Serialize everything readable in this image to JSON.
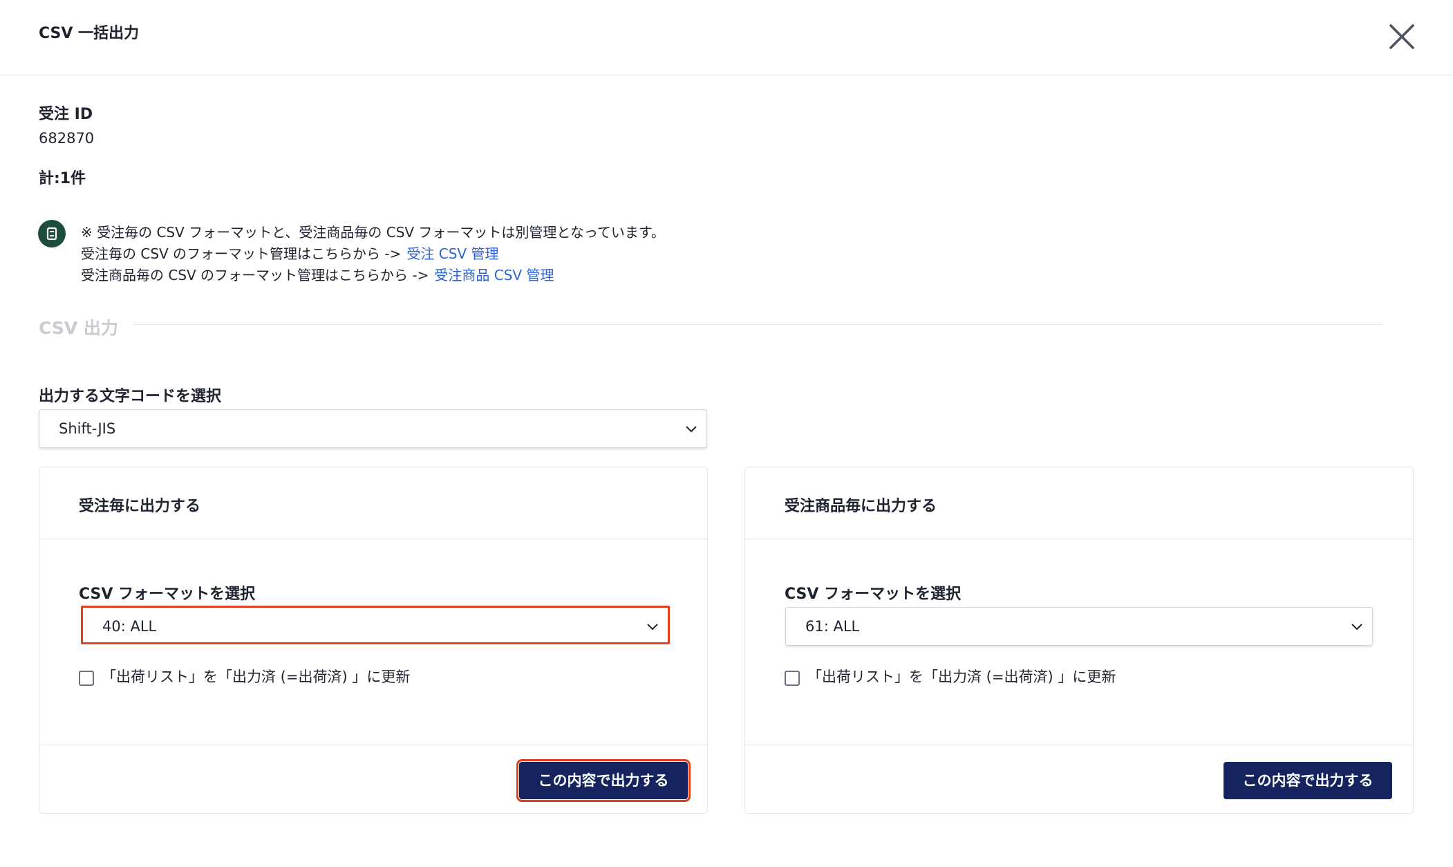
{
  "dialog": {
    "title": "CSV 一括出力"
  },
  "order": {
    "id_label": "受注 ID",
    "id_value": "682870",
    "total": "計:1件"
  },
  "notice": {
    "line1": "※ 受注毎の CSV フォーマットと、受注商品毎の CSV フォーマットは別管理となっています。",
    "line2_text": "受注毎の CSV のフォーマット管理はこちらから ->",
    "line2_link": "受注 CSV 管理",
    "line3_text": "受注商品毎の CSV のフォーマット管理はこちらから ->",
    "line3_link": "受注商品 CSV 管理",
    "icon": "info-icon"
  },
  "section": {
    "title": "CSV 出力"
  },
  "encoding": {
    "label": "出力する文字コードを選択",
    "selected": "Shift-JIS"
  },
  "panels": [
    {
      "title": "受注毎に出力する",
      "format_label": "CSV フォーマットを選択",
      "format_selected": "40: ALL",
      "checkbox_label": "「出荷リスト」を「出力済 (=出荷済) 」に更新",
      "checked": false,
      "button": "この内容で出力する"
    },
    {
      "title": "受注商品毎に出力する",
      "format_label": "CSV フォーマットを選択",
      "format_selected": "61: ALL",
      "checkbox_label": "「出荷リスト」を「出力済 (=出荷済) 」に更新",
      "checked": false,
      "button": "この内容で出力する"
    }
  ],
  "colors": {
    "primary_button": "#15245e",
    "link": "#2a62d8",
    "highlight": "#e0401e",
    "info_icon": "#1f4d3d"
  }
}
